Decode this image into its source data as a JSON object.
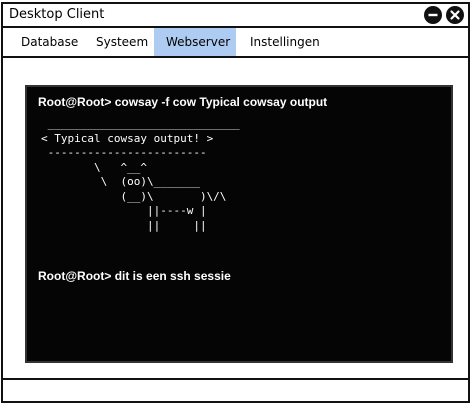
{
  "window": {
    "title": "Desktop Client"
  },
  "tabs": [
    {
      "label": "Database"
    },
    {
      "label": "Systeem"
    },
    {
      "label": "Webserver"
    },
    {
      "label": "Instellingen"
    }
  ],
  "active_tab": "Webserver",
  "terminal": {
    "command_line": "Root@Root> cowsay -f cow Typical cowsay output",
    "output": " _____________________________\n< Typical cowsay output! >\n ------------------------\n        \\   ^__^\n         \\  (oo)\\_______\n            (__)\\       )\\/\\\n                ||----w |\n                ||     ||",
    "second_command_line": "Root@Root> dit is een ssh sessie"
  },
  "icons": {
    "minimize": "minimize-icon",
    "close": "close-icon"
  },
  "colors": {
    "active_tab_bg": "#aecbf2",
    "terminal_bg": "#050505",
    "terminal_fg": "#ffffff"
  }
}
